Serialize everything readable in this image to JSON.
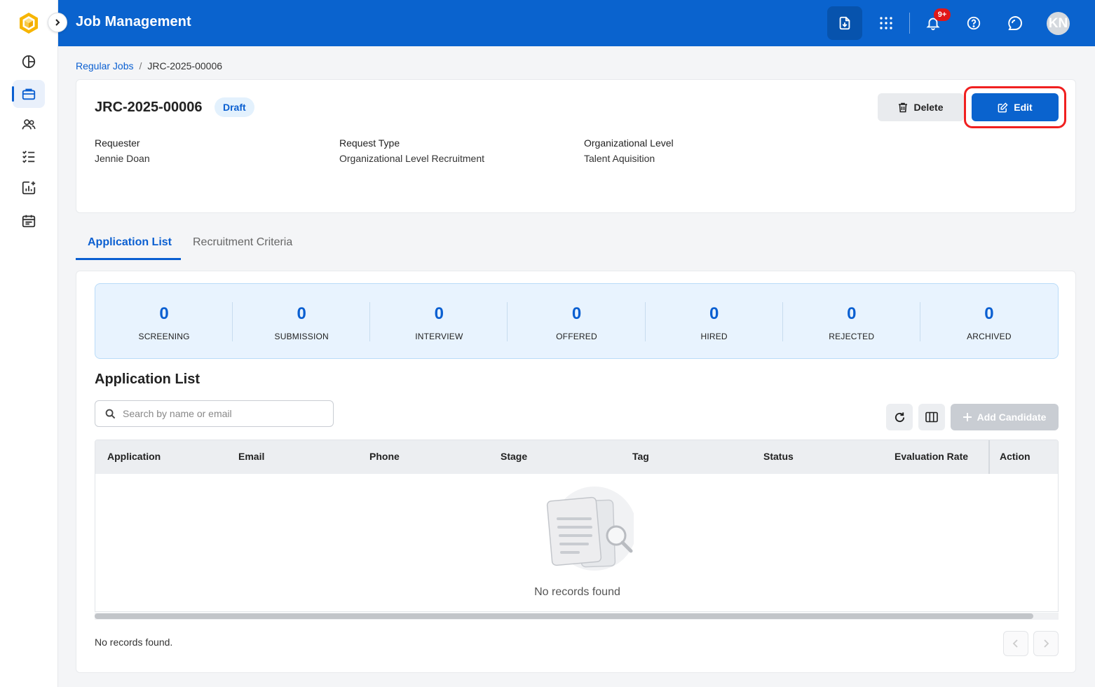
{
  "app": {
    "title": "Job Management",
    "accent_color": "#0a63ce",
    "notification_badge": "9+",
    "user_initials": "KN"
  },
  "sidebar": {
    "items": [
      {
        "icon": "pie-chart-icon",
        "active": false
      },
      {
        "icon": "briefcase-icon",
        "active": true
      },
      {
        "icon": "users-icon",
        "active": false
      },
      {
        "icon": "checklist-icon",
        "active": false
      },
      {
        "icon": "report-add-icon",
        "active": false
      },
      {
        "icon": "calendar-icon",
        "active": false
      }
    ]
  },
  "breadcrumb": {
    "parent": "Regular Jobs",
    "separator": "/",
    "current": "JRC-2025-00006"
  },
  "job": {
    "code": "JRC-2025-00006",
    "status": "Draft",
    "delete_label": "Delete",
    "edit_label": "Edit",
    "fields": [
      {
        "label": "Requester",
        "value": "Jennie Doan"
      },
      {
        "label": "Request Type",
        "value": "Organizational Level Recruitment"
      },
      {
        "label": "Organizational Level",
        "value": "Talent Aquisition"
      }
    ]
  },
  "tabs": [
    {
      "label": "Application List",
      "active": true
    },
    {
      "label": "Recruitment Criteria",
      "active": false
    }
  ],
  "stats": [
    {
      "value": "0",
      "label": "SCREENING"
    },
    {
      "value": "0",
      "label": "SUBMISSION"
    },
    {
      "value": "0",
      "label": "INTERVIEW"
    },
    {
      "value": "0",
      "label": "OFFERED"
    },
    {
      "value": "0",
      "label": "HIRED"
    },
    {
      "value": "0",
      "label": "REJECTED"
    },
    {
      "value": "0",
      "label": "ARCHIVED"
    }
  ],
  "application_list": {
    "title": "Application List",
    "search_placeholder": "Search by name or email",
    "add_candidate_label": "Add Candidate",
    "columns": [
      "Application",
      "Email",
      "Phone",
      "Stage",
      "Tag",
      "Status",
      "Evaluation Rate",
      "Action"
    ],
    "empty_text": "No records found",
    "footer_text": "No records found."
  }
}
